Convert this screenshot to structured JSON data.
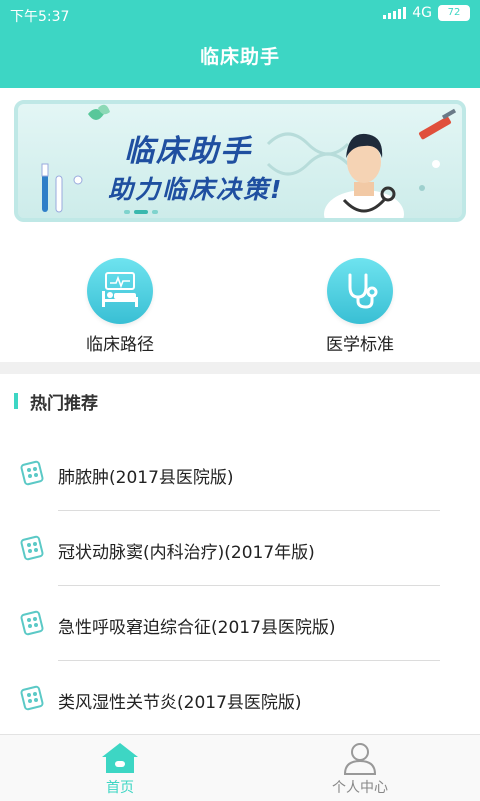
{
  "status_bar": {
    "time": "下午5:37",
    "network": "4G",
    "battery": "72"
  },
  "header": {
    "title": "临床助手"
  },
  "banner": {
    "line1": "临床助手",
    "line2": "助力临床决策!"
  },
  "shortcuts": [
    {
      "label": "临床路径",
      "icon": "hospital-bed-icon"
    },
    {
      "label": "医学标准",
      "icon": "stethoscope-icon"
    }
  ],
  "section": {
    "title": "热门推荐"
  },
  "list": [
    {
      "label": "肺脓肿(2017县医院版)",
      "icon": "pill-pack-icon"
    },
    {
      "label": "冠状动脉窦(内科治疗)(2017年版)",
      "icon": "pill-pack-icon"
    },
    {
      "label": "急性呼吸窘迫综合征(2017县医院版)",
      "icon": "pill-pack-icon"
    },
    {
      "label": "类风湿性关节炎(2017县医院版)",
      "icon": "pill-pack-icon"
    }
  ],
  "bottom_nav": [
    {
      "label": "首页",
      "icon": "home-icon",
      "active": true
    },
    {
      "label": "个人中心",
      "icon": "user-icon",
      "active": false
    }
  ],
  "colors": {
    "accent": "#3dd6c4",
    "banner_text": "#1f4fa0"
  }
}
